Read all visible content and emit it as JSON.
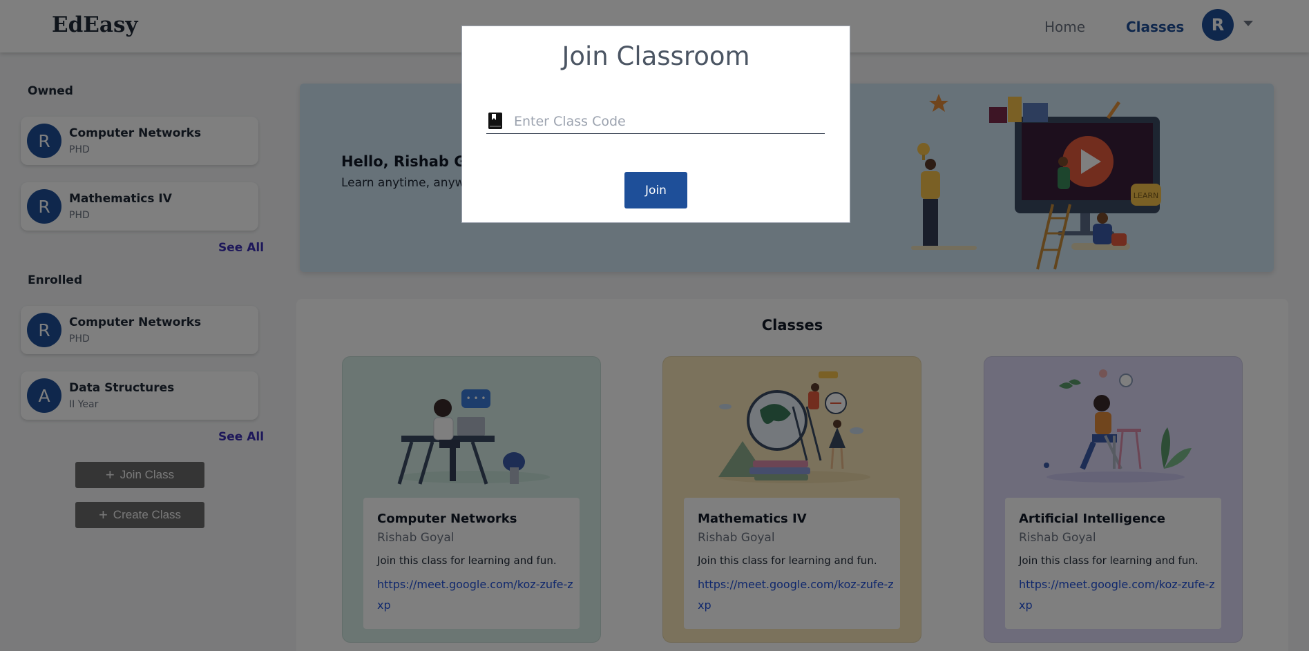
{
  "header": {
    "logo": "EdEasy",
    "nav": {
      "home": "Home",
      "classes": "Classes"
    },
    "avatar_initial": "R"
  },
  "sidebar": {
    "owned_title": "Owned",
    "owned": [
      {
        "initial": "R",
        "name": "Computer Networks",
        "sub": "PHD"
      },
      {
        "initial": "R",
        "name": "Mathematics IV",
        "sub": "PHD"
      }
    ],
    "enrolled_title": "Enrolled",
    "enrolled": [
      {
        "initial": "R",
        "name": "Computer Networks",
        "sub": "PHD"
      },
      {
        "initial": "A",
        "name": "Data Structures",
        "sub": "II Year"
      }
    ],
    "see_all": "See All",
    "join_class": "Join Class",
    "create_class": "Create Class"
  },
  "banner": {
    "greeting": "Hello, Rishab Goy",
    "tagline": "Learn anytime, anyw",
    "illustration_text": "LEARN"
  },
  "classes": {
    "title": "Classes",
    "cards": [
      {
        "name": "Computer Networks",
        "teacher": "Rishab Goyal",
        "desc": "Join this class for learning and fun.",
        "link": "https://meet.google.com/koz-zufe-zxp",
        "bg": "#d6ede6"
      },
      {
        "name": "Mathematics IV",
        "teacher": "Rishab Goyal",
        "desc": "Join this class for learning and fun.",
        "link": "https://meet.google.com/koz-zufe-zxp",
        "bg": "#f6e4b8"
      },
      {
        "name": "Artificial Intelligence",
        "teacher": "Rishab Goyal",
        "desc": "Join this class for learning and fun.",
        "link": "https://meet.google.com/koz-zufe-zxp",
        "bg": "#dcd9f6"
      }
    ]
  },
  "modal": {
    "title": "Join Classroom",
    "input_placeholder": "Enter Class Code",
    "input_value": "",
    "join_label": "Join"
  },
  "colors": {
    "primary": "#1e4f99",
    "link": "#1e4fd8",
    "see_all": "#3b2fb5",
    "banner_bg": "#cfe4f3"
  }
}
